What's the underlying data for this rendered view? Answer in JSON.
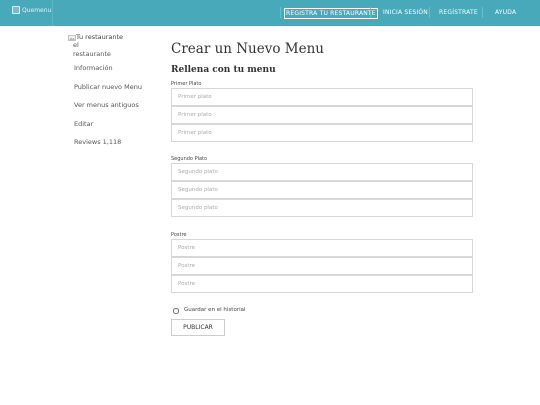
{
  "header": {
    "logo_alt": "Quemenu",
    "nav": [
      {
        "label": "REGISTRA TU RESTAURANTE"
      },
      {
        "label": "INICIA SESIÓN"
      },
      {
        "label": "REGÍSTRATE"
      },
      {
        "label": "AYUDA"
      }
    ]
  },
  "sidebar": {
    "user_name": "Tu restaurante",
    "avatar_alt": "el restaurante",
    "items": [
      {
        "label": "Información"
      },
      {
        "label": "Publicar nuevo Menu"
      },
      {
        "label": "Ver menus antiguos"
      },
      {
        "label": "Editar"
      },
      {
        "label": "Reviews 1,118"
      }
    ]
  },
  "main": {
    "title": "Crear un Nuevo Menu",
    "subtitle": "Rellena con tu menu",
    "sections": [
      {
        "label": "Primer Plato",
        "placeholder": "Primer plato"
      },
      {
        "label": "Segundo Plato",
        "placeholder": "Segundo plato"
      },
      {
        "label": "Postre",
        "placeholder": "Postre"
      }
    ],
    "history_checkbox": {
      "label": "Guardar en el historial",
      "checked": false
    },
    "submit_label": "PUBLICAR"
  }
}
